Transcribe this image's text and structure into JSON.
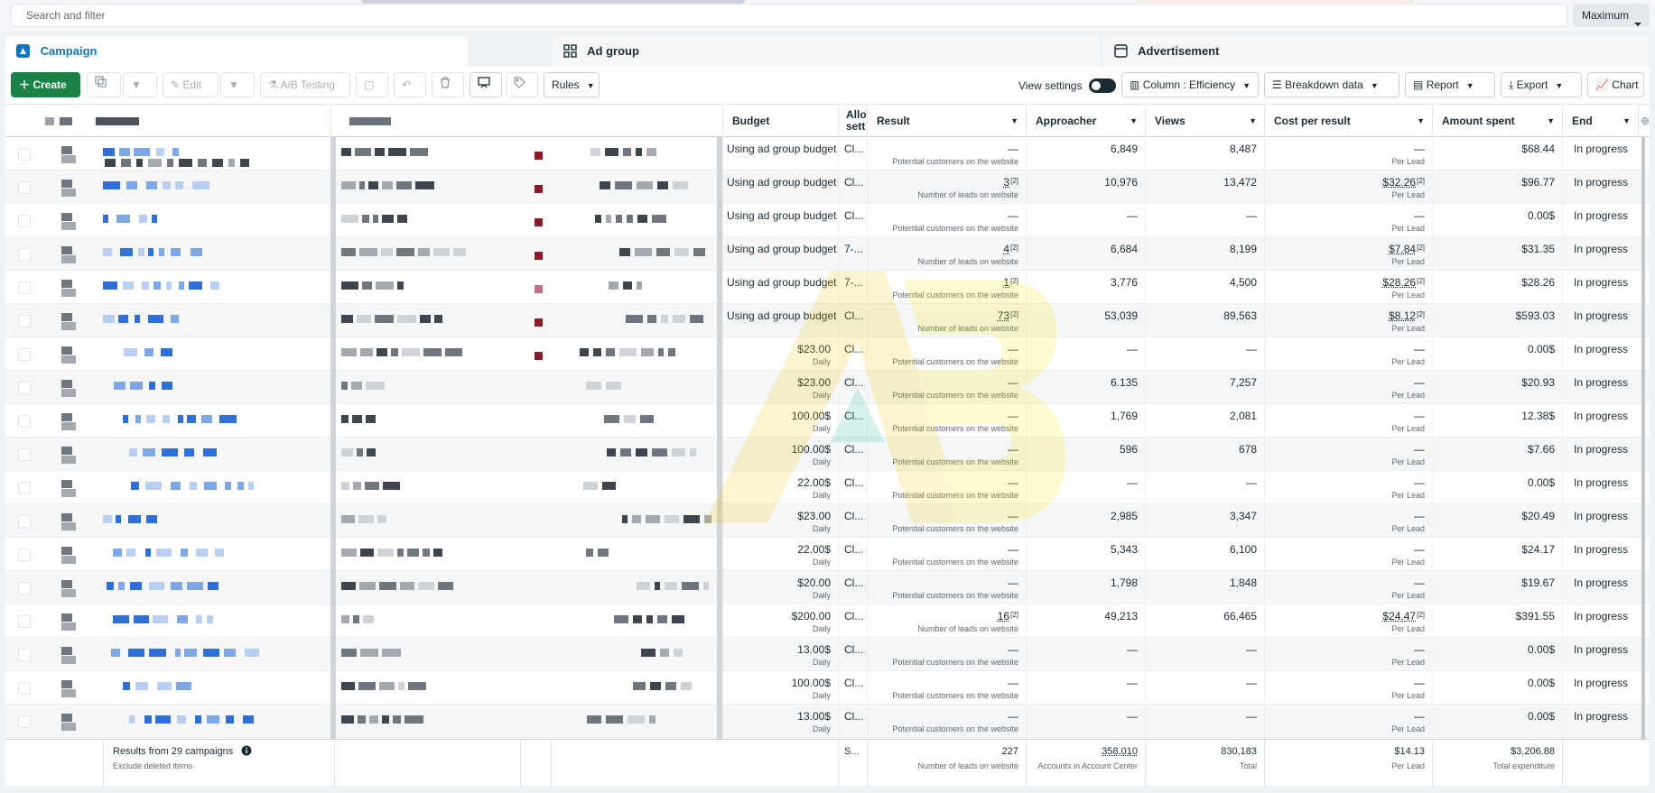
{
  "search": {
    "placeholder": "Search and filter"
  },
  "date_range": {
    "label": "Maximum"
  },
  "tabs": [
    {
      "label": "Campaign",
      "active": true,
      "icon": "campaign-icon"
    },
    {
      "label": "Ad group",
      "active": false,
      "icon": "grid-icon"
    },
    {
      "label": "Advertisement",
      "active": false,
      "icon": "ad-icon"
    }
  ],
  "toolbar": {
    "create": "Create",
    "edit": "Edit",
    "ab_testing": "A/B Testing",
    "rules": "Rules",
    "view_settings": "View settings",
    "columns": "Column : Efficiency",
    "breakdown": "Breakdown data",
    "report": "Report",
    "export": "Export",
    "chart": "Chart"
  },
  "columns": [
    "Budget",
    "Allo sett",
    "Result",
    "Approacher",
    "Views",
    "Cost per result",
    "Amount spent",
    "End"
  ],
  "rows": [
    {
      "budget": "Using ad group budget",
      "budget_sub": "",
      "alloc": "Cl...",
      "result": "—",
      "result_note": "",
      "result_sub": "Potential customers on the website",
      "approacher": "6,849",
      "views": "8,487",
      "cost": "—",
      "cost_note": "",
      "cost_sub": "Per Lead",
      "spent": "$68.44",
      "end": "In progress"
    },
    {
      "budget": "Using ad group budget",
      "budget_sub": "",
      "alloc": "Cl...",
      "result": "3",
      "result_note": "[2]",
      "result_sub": "Number of leads on website",
      "approacher": "10,976",
      "views": "13,472",
      "cost": "$32.26",
      "cost_note": "[2]",
      "cost_sub": "Per Lead",
      "spent": "$96.77",
      "end": "In progress"
    },
    {
      "budget": "Using ad group budget",
      "budget_sub": "",
      "alloc": "Cl...",
      "result": "—",
      "result_note": "",
      "result_sub": "Potential customers on the website",
      "approacher": "—",
      "views": "—",
      "cost": "—",
      "cost_note": "",
      "cost_sub": "Per Lead",
      "spent": "0.00$",
      "end": "In progress"
    },
    {
      "budget": "Using ad group budget",
      "budget_sub": "",
      "alloc": "7-...",
      "result": "4",
      "result_note": "[2]",
      "result_sub": "Number of leads on website",
      "approacher": "6,684",
      "views": "8,199",
      "cost": "$7.84",
      "cost_note": "[2]",
      "cost_sub": "Per Lead",
      "spent": "$31.35",
      "end": "In progress"
    },
    {
      "budget": "Using ad group budget",
      "budget_sub": "",
      "alloc": "7-...",
      "result": "1",
      "result_note": "[2]",
      "result_sub": "Potential customers on the website",
      "approacher": "3,776",
      "views": "4,500",
      "cost": "$28.26",
      "cost_note": "[2]",
      "cost_sub": "Per Lead",
      "spent": "$28.26",
      "end": "In progress"
    },
    {
      "budget": "Using ad group budget",
      "budget_sub": "",
      "alloc": "Cl...",
      "result": "73",
      "result_note": "[2]",
      "result_sub": "Number of leads on website",
      "approacher": "53,039",
      "views": "89,563",
      "cost": "$8.12",
      "cost_note": "[2]",
      "cost_sub": "Per Lead",
      "spent": "$593.03",
      "end": "In progress"
    },
    {
      "budget": "$23.00",
      "budget_sub": "Daily",
      "alloc": "Cl...",
      "result": "—",
      "result_note": "",
      "result_sub": "Potential customers on the website",
      "approacher": "—",
      "views": "—",
      "cost": "—",
      "cost_note": "",
      "cost_sub": "Per Lead",
      "spent": "0.00$",
      "end": "In progress"
    },
    {
      "budget": "$23.00",
      "budget_sub": "Daily",
      "alloc": "Cl...",
      "result": "—",
      "result_note": "",
      "result_sub": "Potential customers on the website",
      "approacher": "6.135",
      "views": "7,257",
      "cost": "—",
      "cost_note": "",
      "cost_sub": "Per Lead",
      "spent": "$20.93",
      "end": "In progress"
    },
    {
      "budget": "100.00$",
      "budget_sub": "Daily",
      "alloc": "Cl...",
      "result": "—",
      "result_note": "",
      "result_sub": "Potential customers on the website",
      "approacher": "1,769",
      "views": "2,081",
      "cost": "—",
      "cost_note": "",
      "cost_sub": "Per Lead",
      "spent": "12.38$",
      "end": "In progress"
    },
    {
      "budget": "100.00$",
      "budget_sub": "Daily",
      "alloc": "Cl...",
      "result": "—",
      "result_note": "",
      "result_sub": "Potential customers on the website",
      "approacher": "596",
      "views": "678",
      "cost": "—",
      "cost_note": "",
      "cost_sub": "Per Lead",
      "spent": "$7.66",
      "end": "In progress"
    },
    {
      "budget": "22.00$",
      "budget_sub": "Daily",
      "alloc": "Cl...",
      "result": "—",
      "result_note": "",
      "result_sub": "Potential customers on the website",
      "approacher": "—",
      "views": "—",
      "cost": "—",
      "cost_note": "",
      "cost_sub": "Per Lead",
      "spent": "0.00$",
      "end": "In progress"
    },
    {
      "budget": "$23.00",
      "budget_sub": "Daily",
      "alloc": "Cl...",
      "result": "—",
      "result_note": "",
      "result_sub": "Potential customers on the website",
      "approacher": "2,985",
      "views": "3,347",
      "cost": "—",
      "cost_note": "",
      "cost_sub": "Per Lead",
      "spent": "$20.49",
      "end": "In progress"
    },
    {
      "budget": "22.00$",
      "budget_sub": "Daily",
      "alloc": "Cl...",
      "result": "—",
      "result_note": "",
      "result_sub": "Potential customers on the website",
      "approacher": "5,343",
      "views": "6,100",
      "cost": "—",
      "cost_note": "",
      "cost_sub": "Per Lead",
      "spent": "$24.17",
      "end": "In progress"
    },
    {
      "budget": "$20.00",
      "budget_sub": "Daily",
      "alloc": "Cl...",
      "result": "—",
      "result_note": "",
      "result_sub": "Potential customers on the website",
      "approacher": "1,798",
      "views": "1,848",
      "cost": "—",
      "cost_note": "",
      "cost_sub": "Per Lead",
      "spent": "$19.67",
      "end": "In progress"
    },
    {
      "budget": "$200.00",
      "budget_sub": "Daily",
      "alloc": "Cl...",
      "result": "16",
      "result_note": "[2]",
      "result_sub": "Number of leads on website",
      "approacher": "49,213",
      "views": "66,465",
      "cost": "$24.47",
      "cost_note": "[2]",
      "cost_sub": "Per Lead",
      "spent": "$391.55",
      "end": "In progress"
    },
    {
      "budget": "13.00$",
      "budget_sub": "Daily",
      "alloc": "Cl...",
      "result": "—",
      "result_note": "",
      "result_sub": "Potential customers on the website",
      "approacher": "—",
      "views": "—",
      "cost": "—",
      "cost_note": "",
      "cost_sub": "Per Lead",
      "spent": "0.00$",
      "end": "In progress"
    },
    {
      "budget": "100.00$",
      "budget_sub": "Daily",
      "alloc": "Cl...",
      "result": "—",
      "result_note": "",
      "result_sub": "Potential customers on the website",
      "approacher": "—",
      "views": "—",
      "cost": "—",
      "cost_note": "",
      "cost_sub": "Per Lead",
      "spent": "0.00$",
      "end": "In progress"
    },
    {
      "budget": "13.00$",
      "budget_sub": "Daily",
      "alloc": "Cl...",
      "result": "—",
      "result_note": "",
      "result_sub": "Potential customers on the website",
      "approacher": "—",
      "views": "—",
      "cost": "—",
      "cost_note": "",
      "cost_sub": "Per Lead",
      "spent": "0.00$",
      "end": "In progress"
    }
  ],
  "footer": {
    "campaigns": "Results from 29 campaigns",
    "exclude": "Exclude deleted items",
    "alloc": "S...",
    "result": "227",
    "result_sub": "Number of leads on website",
    "approacher": "358,010",
    "approacher_sub": "Accounts in Account Center",
    "views": "830,183",
    "views_sub": "Total",
    "cost": "$14.13",
    "cost_sub": "Per Lead",
    "spent": "$3,206.88",
    "spent_sub": "Total expenditure"
  },
  "colors": {
    "accent": "#0a78be",
    "create": "#1a8245",
    "redacted_blue": "#2f6fd6",
    "redacted_gray": "#5b6168",
    "redacted_red": "#8b1a2b"
  }
}
